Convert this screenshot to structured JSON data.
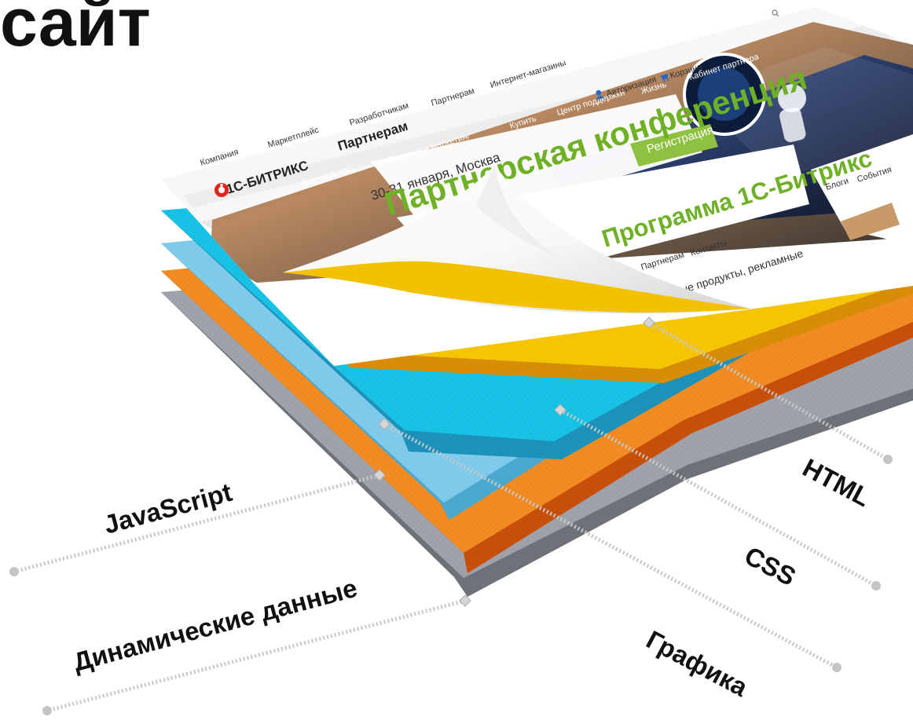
{
  "title": "сайт",
  "layers": [
    {
      "key": "html",
      "label": "HTML",
      "color": "#f3c300"
    },
    {
      "key": "css",
      "label": "CSS",
      "color": "#12c0e2"
    },
    {
      "key": "graphics",
      "label": "Графика",
      "color": "#71c7ea"
    },
    {
      "key": "javascript",
      "label": "JavaScript",
      "color": "#f08920"
    },
    {
      "key": "dynamic",
      "label": "Динамические данные",
      "color": "#8b8f98"
    }
  ],
  "website": {
    "brand": "1С-БИТРИКС",
    "top_nav": [
      "Компания",
      "Маркетплейс",
      "Разработчикам",
      "Партнерам",
      "Интернет-магазины"
    ],
    "green_nav": [
      "Партнерство",
      "Продажи и маркетинг",
      "Купить",
      "Центр поддержки",
      "Жизнь",
      "Кабинет партнера"
    ],
    "section_title": "Партнерам",
    "event_date": "30-31 января, Москва",
    "headline": "Партнерская конференция",
    "register_button": "Регистрация",
    "program_title": "Программа 1С-Битрикс",
    "program_tabs": [
      "Партнерам",
      "Контакты"
    ],
    "body_text": "новые продукты, рекламные",
    "news_tabs": [
      "Блоги",
      "События"
    ],
    "auth_link": "Авторизация",
    "cart_link": "Корзина"
  },
  "colors": {
    "title": "#111111",
    "page_green": "#7cb12f",
    "leader_line": "#c7c7c7"
  }
}
